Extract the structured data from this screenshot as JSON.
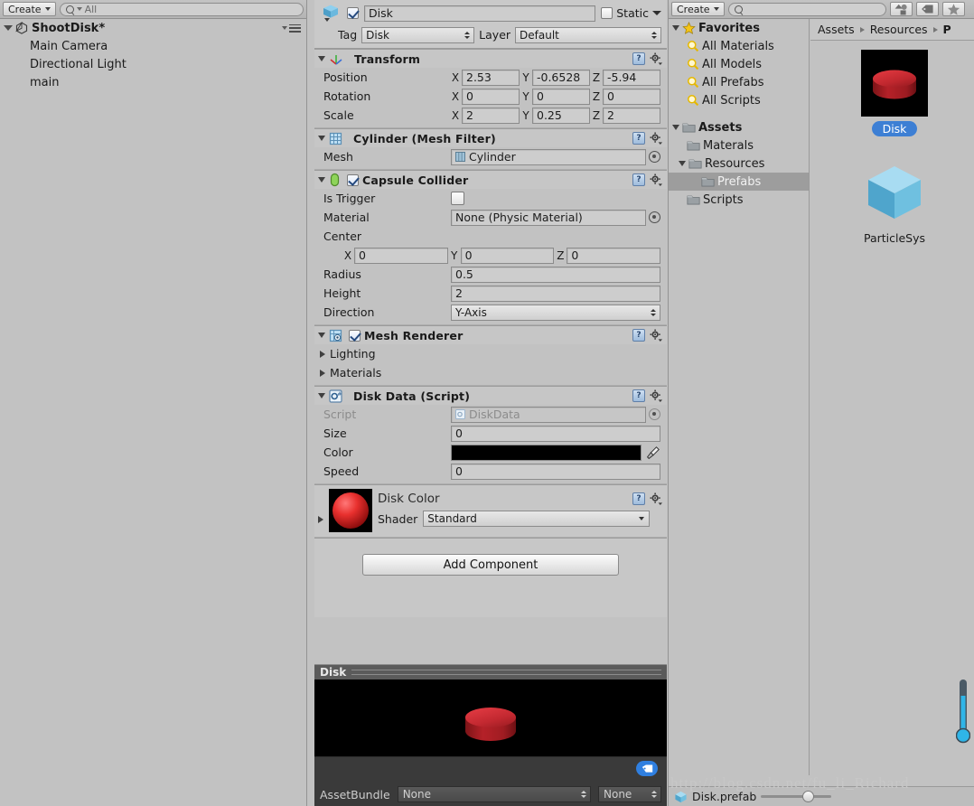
{
  "hierarchy": {
    "create_label": "Create",
    "search_placeholder": "All",
    "scene_name": "ShootDisk*",
    "items": [
      {
        "label": "Main Camera"
      },
      {
        "label": "Directional Light"
      },
      {
        "label": "main"
      }
    ]
  },
  "inspector": {
    "object_name": "Disk",
    "static_label": "Static",
    "tag_label": "Tag",
    "tag_value": "Disk",
    "layer_label": "Layer",
    "layer_value": "Default",
    "transform": {
      "title": "Transform",
      "rows": [
        {
          "label": "Position",
          "x": "2.53",
          "y": "-0.6528",
          "z": "-5.94"
        },
        {
          "label": "Rotation",
          "x": "0",
          "y": "0",
          "z": "0"
        },
        {
          "label": "Scale",
          "x": "2",
          "y": "0.25",
          "z": "2"
        }
      ],
      "axis_x": "X",
      "axis_y": "Y",
      "axis_z": "Z"
    },
    "mesh_filter": {
      "title": "Cylinder (Mesh Filter)",
      "mesh_label": "Mesh",
      "mesh_value": "Cylinder"
    },
    "capsule_collider": {
      "title": "Capsule Collider",
      "is_trigger_label": "Is Trigger",
      "material_label": "Material",
      "material_value": "None (Physic Material)",
      "center_label": "Center",
      "center_x": "0",
      "center_y": "0",
      "center_z": "0",
      "radius_label": "Radius",
      "radius_value": "0.5",
      "height_label": "Height",
      "height_value": "2",
      "direction_label": "Direction",
      "direction_value": "Y-Axis"
    },
    "mesh_renderer": {
      "title": "Mesh Renderer",
      "lighting_label": "Lighting",
      "materials_label": "Materials"
    },
    "disk_data": {
      "title": "Disk Data (Script)",
      "script_label": "Script",
      "script_value": "DiskData",
      "size_label": "Size",
      "size_value": "0",
      "color_label": "Color",
      "color_value": "#000000",
      "speed_label": "Speed",
      "speed_value": "0"
    },
    "material": {
      "title": "Disk Color",
      "shader_label": "Shader",
      "shader_value": "Standard"
    },
    "add_component_label": "Add Component",
    "preview": {
      "title": "Disk",
      "assetbundle_label": "AssetBundle",
      "assetbundle_value": "None",
      "variant_value": "None"
    }
  },
  "project": {
    "create_label": "Create",
    "search_placeholder": "",
    "breadcrumb": [
      "Assets",
      "Resources",
      "P"
    ],
    "tree": [
      {
        "label": "Favorites",
        "kind": "favorites",
        "depth": 0,
        "bold": true,
        "expanded": true
      },
      {
        "label": "All Materials",
        "kind": "search",
        "depth": 1
      },
      {
        "label": "All Models",
        "kind": "search",
        "depth": 1
      },
      {
        "label": "All Prefabs",
        "kind": "search",
        "depth": 1
      },
      {
        "label": "All Scripts",
        "kind": "search",
        "depth": 1
      },
      {
        "label": "Assets",
        "kind": "folder",
        "depth": 0,
        "bold": true,
        "expanded": true
      },
      {
        "label": "Materals",
        "kind": "folder",
        "depth": 1
      },
      {
        "label": "Resources",
        "kind": "folder",
        "depth": 1,
        "expanded": true
      },
      {
        "label": "Prefabs",
        "kind": "folder",
        "depth": 2,
        "selected": true
      },
      {
        "label": "Scripts",
        "kind": "folder",
        "depth": 1
      }
    ],
    "assets": [
      {
        "label": "Disk",
        "kind": "disk-prefab",
        "selected": true
      },
      {
        "label": "ParticleSys",
        "kind": "cube-prefab",
        "selected": false
      }
    ],
    "status": {
      "selected_asset": "Disk.prefab",
      "zoom_value": "60"
    },
    "watermark": "http://blog.csdn.net/fu_li_Richard"
  },
  "icons": {
    "create_caret": "chevron-down-icon",
    "search": "search-icon",
    "hierarchy_menu": "hamburger-menu-icon",
    "filter_type": "type-filter-icon",
    "filter_label": "label-filter-icon",
    "filter_favorite": "star-filter-icon",
    "help": "?",
    "gear": "gear-icon",
    "eyedropper": "eyedropper-icon",
    "tag": "tag-icon"
  }
}
